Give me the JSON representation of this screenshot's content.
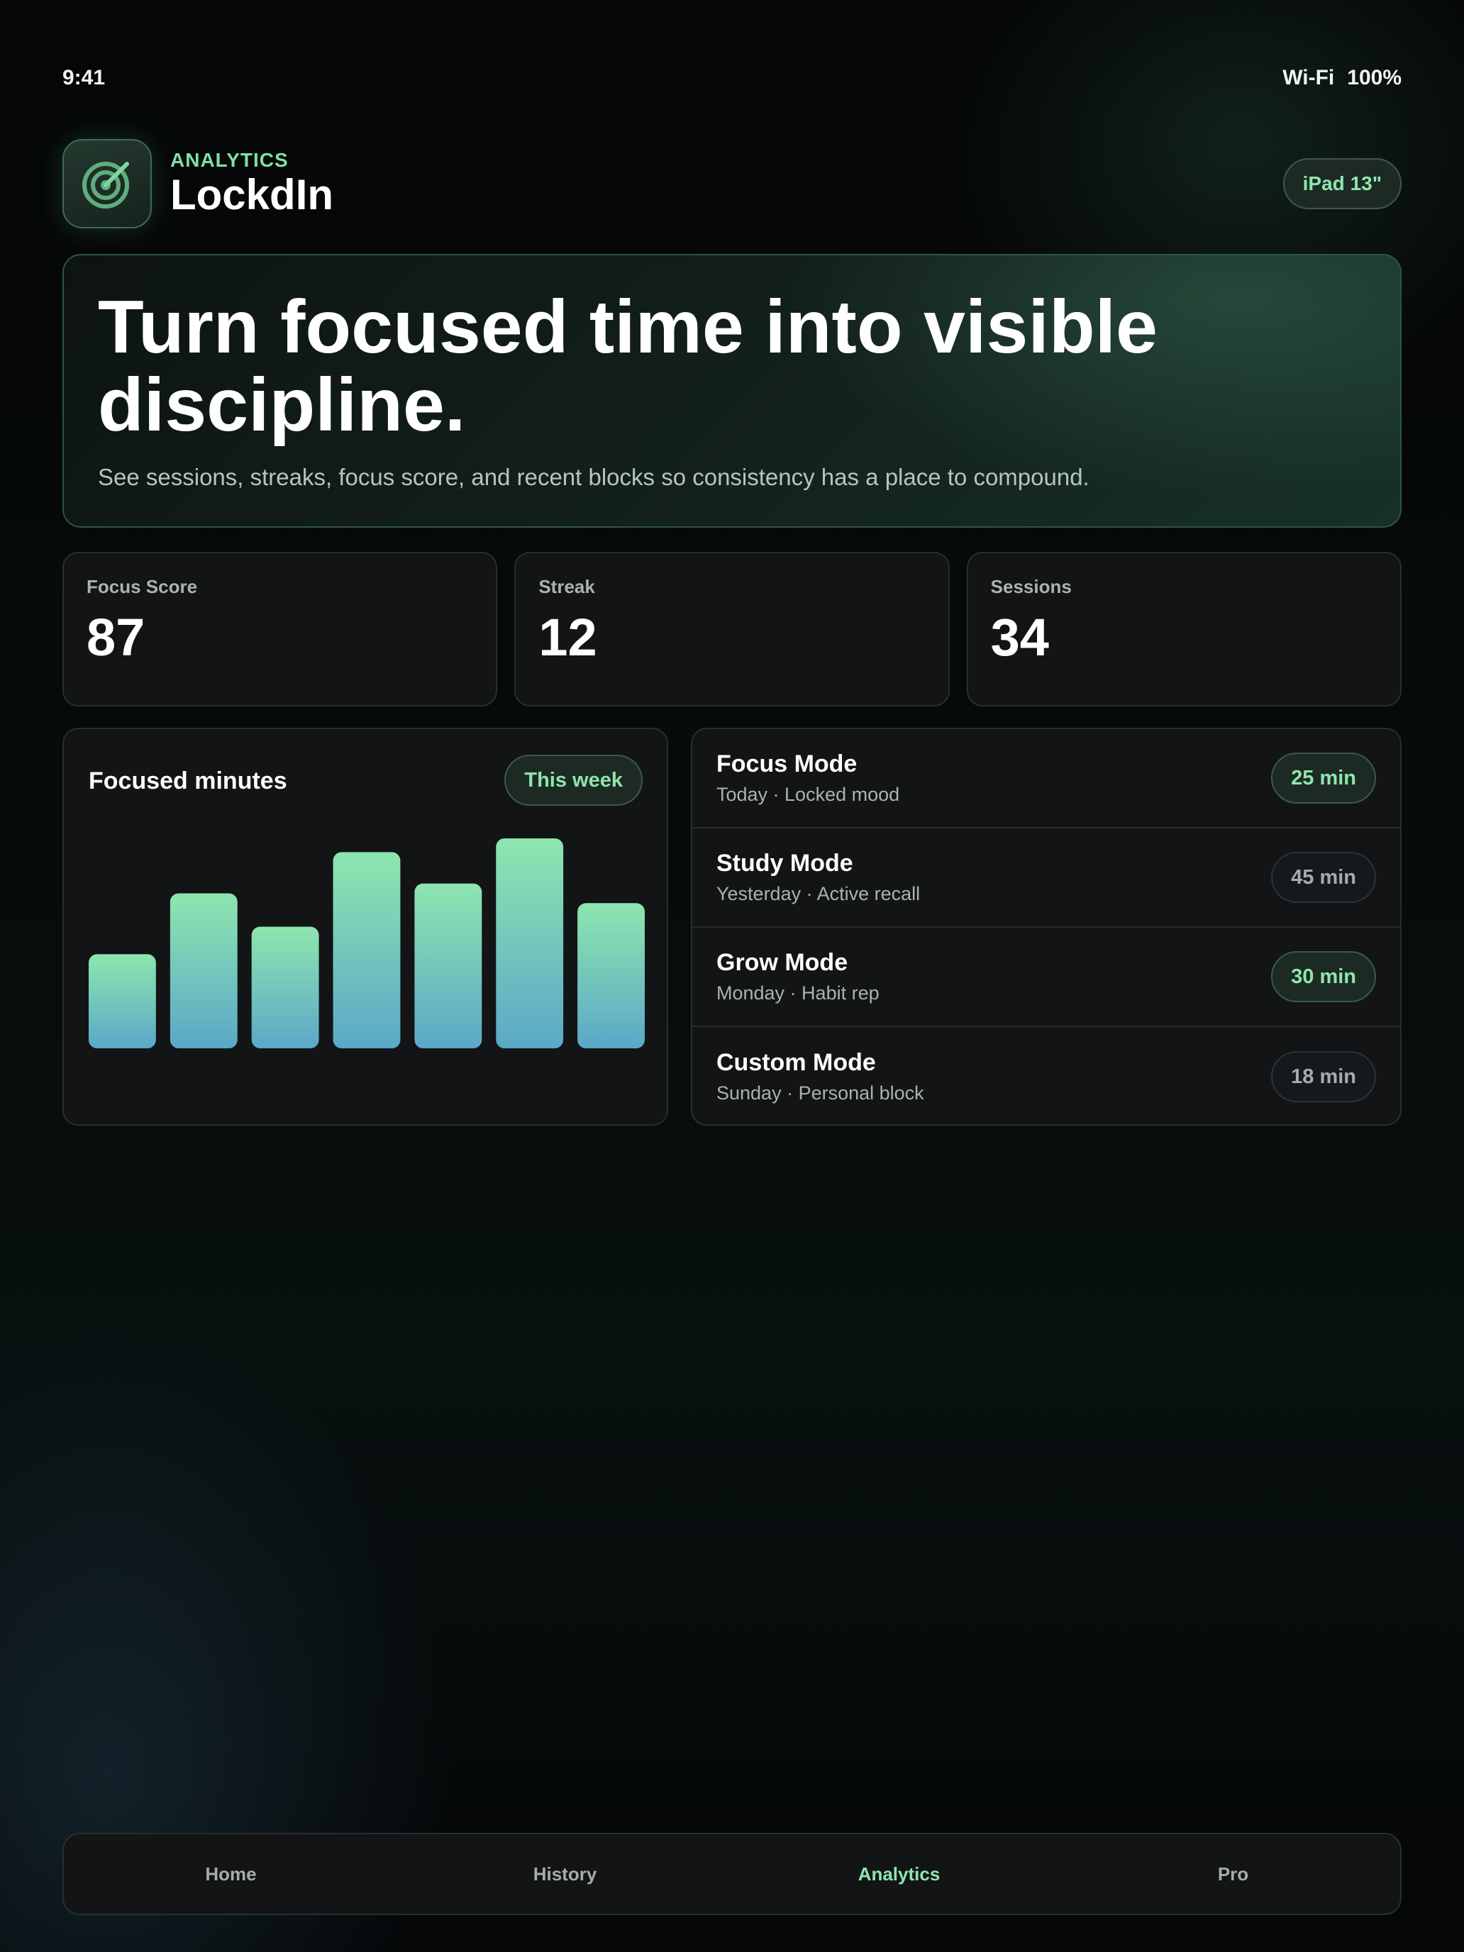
{
  "status_bar": {
    "time": "9:41",
    "wifi": "Wi-Fi",
    "battery": "100%"
  },
  "header": {
    "eyebrow": "ANALYTICS",
    "title": "LockdIn",
    "device_chip": "iPad 13\"",
    "icon": "target-icon"
  },
  "hero": {
    "title": "Turn focused time into visible discipline.",
    "subtitle": "See sessions, streaks, focus score, and recent blocks so consistency has a place to compound."
  },
  "stats": [
    {
      "label": "Focus Score",
      "value": "87"
    },
    {
      "label": "Streak",
      "value": "12"
    },
    {
      "label": "Sessions",
      "value": "34"
    }
  ],
  "chart": {
    "title": "Focused minutes",
    "range_pill": "This week",
    "colors": {
      "top": "#8ee6ae",
      "bottom": "#5aa8c8"
    }
  },
  "chart_data": {
    "type": "bar",
    "title": "Focused minutes",
    "categories": [],
    "values": [
      48,
      79,
      62,
      100,
      84,
      107,
      74
    ],
    "ylim": [
      0,
      107
    ],
    "grid": false,
    "note_units": ""
  },
  "sessions": [
    {
      "title": "Focus Mode",
      "subtitle": "Today · Locked mood",
      "duration": "25 min",
      "style": "green"
    },
    {
      "title": "Study Mode",
      "subtitle": "Yesterday · Active recall",
      "duration": "45 min",
      "style": "gray"
    },
    {
      "title": "Grow Mode",
      "subtitle": "Monday · Habit rep",
      "duration": "30 min",
      "style": "green"
    },
    {
      "title": "Custom Mode",
      "subtitle": "Sunday · Personal block",
      "duration": "18 min",
      "style": "gray"
    }
  ],
  "tabs": [
    {
      "label": "Home",
      "active": false
    },
    {
      "label": "History",
      "active": false
    },
    {
      "label": "Analytics",
      "active": true
    },
    {
      "label": "Pro",
      "active": false
    }
  ],
  "accent_color": "#8ee6ae"
}
